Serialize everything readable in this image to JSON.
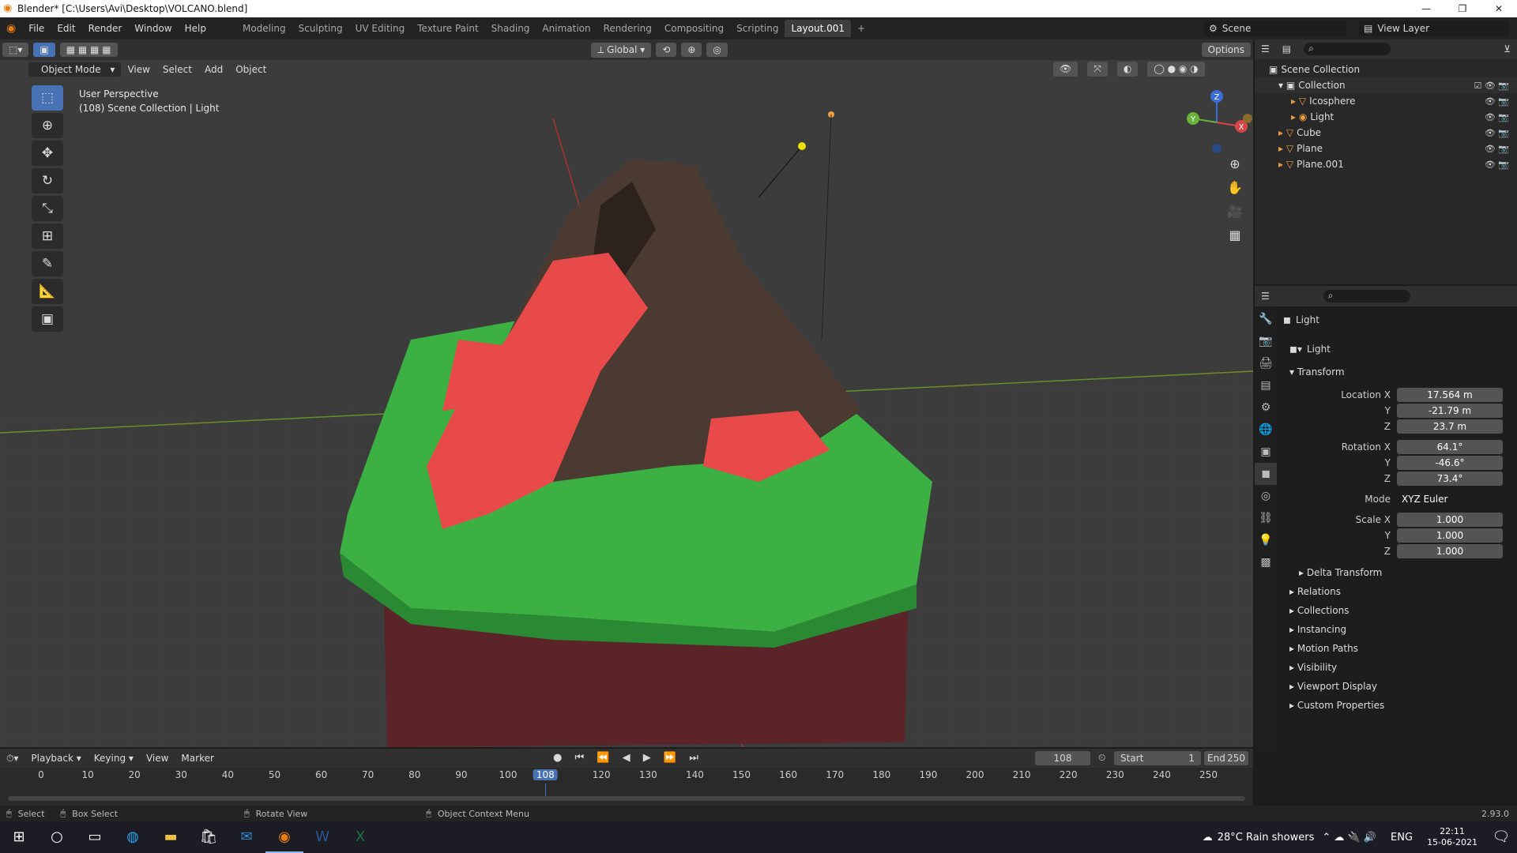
{
  "window": {
    "title": "Blender* [C:\\Users\\Avi\\Desktop\\VOLCANO.blend]",
    "minimize": "—",
    "restore": "❐",
    "close": "✕"
  },
  "menus": [
    "File",
    "Edit",
    "Render",
    "Window",
    "Help"
  ],
  "workspaces": [
    "Modeling",
    "Sculpting",
    "UV Editing",
    "Texture Paint",
    "Shading",
    "Animation",
    "Rendering",
    "Compositing",
    "Scripting",
    "Layout.001"
  ],
  "active_workspace": "Layout.001",
  "scene": {
    "label": "Scene",
    "view_layer": "View Layer"
  },
  "viewport_header": {
    "orientation": "Global",
    "options": "Options"
  },
  "mode_bar": {
    "mode": "Object Mode",
    "items": [
      "View",
      "Select",
      "Add",
      "Object"
    ]
  },
  "viewport_info": {
    "line1": "User Perspective",
    "line2": "(108) Scene Collection | Light"
  },
  "gizmo": {
    "x": "X",
    "y": "Y",
    "z": "Z"
  },
  "outliner": {
    "root": "Scene Collection",
    "items": [
      {
        "name": "Collection",
        "depth": 1,
        "type": "collection"
      },
      {
        "name": "Icosphere",
        "depth": 2,
        "type": "mesh"
      },
      {
        "name": "Light",
        "depth": 2,
        "type": "light"
      },
      {
        "name": "Cube",
        "depth": 1,
        "type": "mesh"
      },
      {
        "name": "Plane",
        "depth": 1,
        "type": "mesh"
      },
      {
        "name": "Plane.001",
        "depth": 1,
        "type": "mesh"
      }
    ]
  },
  "properties": {
    "object_name": "Light",
    "object_field": "Light",
    "transform_header": "Transform",
    "location": {
      "label_x": "Location X",
      "x": "17.564 m",
      "y": "-21.79 m",
      "z": "23.7 m"
    },
    "rotation": {
      "label_x": "Rotation X",
      "x": "64.1°",
      "y": "-46.6°",
      "z": "73.4°"
    },
    "mode": {
      "label": "Mode",
      "value": "XYZ Euler"
    },
    "scale": {
      "label_x": "Scale X",
      "x": "1.000",
      "y": "1.000",
      "z": "1.000"
    },
    "axis_y": "Y",
    "axis_z": "Z",
    "sections": [
      "Delta Transform",
      "Relations",
      "Collections",
      "Instancing",
      "Motion Paths",
      "Visibility",
      "Viewport Display",
      "Custom Properties"
    ]
  },
  "timeline": {
    "menus": [
      "Playback",
      "Keying",
      "View",
      "Marker"
    ],
    "current_frame": "108",
    "start_label": "Start",
    "start": "1",
    "end_label": "End",
    "end": "250",
    "ticks": [
      "0",
      "10",
      "20",
      "30",
      "40",
      "50",
      "60",
      "70",
      "80",
      "90",
      "100",
      "108",
      "120",
      "130",
      "140",
      "150",
      "160",
      "170",
      "180",
      "190",
      "200",
      "210",
      "220",
      "230",
      "240",
      "250"
    ]
  },
  "status_bar": {
    "select": "Select",
    "box_select": "Box Select",
    "rotate": "Rotate View",
    "context": "Object Context Menu",
    "version": "2.93.0"
  },
  "taskbar": {
    "weather": "28°C  Rain showers",
    "lang": "ENG",
    "time": "22:11",
    "date": "15-06-2021"
  },
  "icons": [
    "blender-logo-icon",
    "search-icon",
    "filter-icon",
    "eye-icon",
    "camera-icon",
    "mesh-icon",
    "light-icon",
    "collection-icon",
    "move-icon",
    "rotate-icon",
    "scale-icon",
    "cursor-icon",
    "annotate-icon",
    "measure-icon",
    "add-cube-icon",
    "zoom-icon",
    "hand-icon",
    "camera-view-icon",
    "grid-icon",
    "play-icon",
    "windows-start-icon"
  ],
  "colors": {
    "accent": "#4772b3",
    "grass": "#3cb043",
    "lava": "#e84a4a",
    "rock": "#4a3a32",
    "active_frame": "#4772b3"
  }
}
